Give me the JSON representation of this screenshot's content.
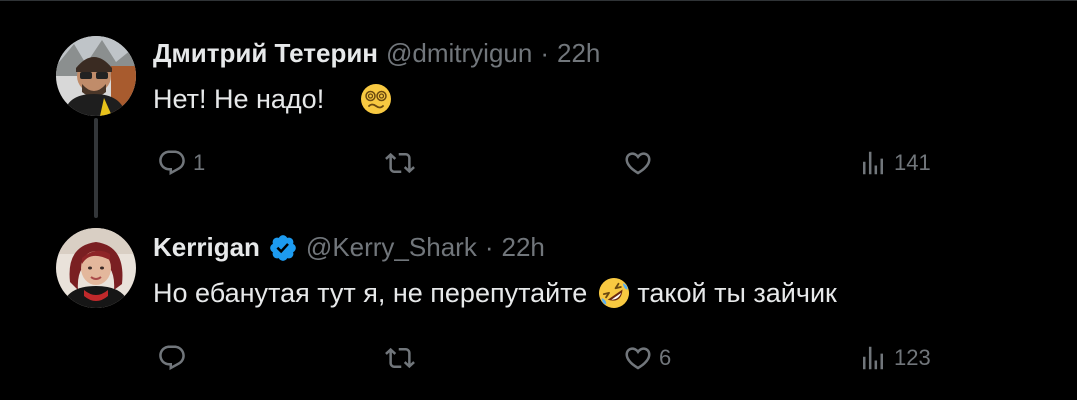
{
  "colors": {
    "background": "#000000",
    "text": "#e7e9ea",
    "muted": "#71767b",
    "verified": "#1d9bf0",
    "thread_line": "#333639"
  },
  "tweets": [
    {
      "author_name": "Дмитрий Тетерин",
      "handle": "@dmitryigun",
      "separator": "·",
      "time": "22h",
      "verified": false,
      "text_parts": [
        "Нет! Не надо!"
      ],
      "emoji": "face-with-spiral-eyes",
      "actions": {
        "reply": {
          "icon": "reply-icon",
          "count": "1"
        },
        "retweet": {
          "icon": "retweet-icon",
          "count": ""
        },
        "like": {
          "icon": "heart-icon",
          "count": ""
        },
        "views": {
          "icon": "views-icon",
          "count": "141"
        }
      }
    },
    {
      "author_name": "Kerrigan",
      "handle": "@Kerry_Shark",
      "separator": "·",
      "time": "22h",
      "verified": true,
      "text_parts": [
        "Но ебанутая тут я, не перепутайте",
        "такой ты зайчик"
      ],
      "emoji": "rolling-on-floor-laughing",
      "actions": {
        "reply": {
          "icon": "reply-icon",
          "count": ""
        },
        "retweet": {
          "icon": "retweet-icon",
          "count": ""
        },
        "like": {
          "icon": "heart-icon",
          "count": "6"
        },
        "views": {
          "icon": "views-icon",
          "count": "123"
        }
      }
    }
  ]
}
